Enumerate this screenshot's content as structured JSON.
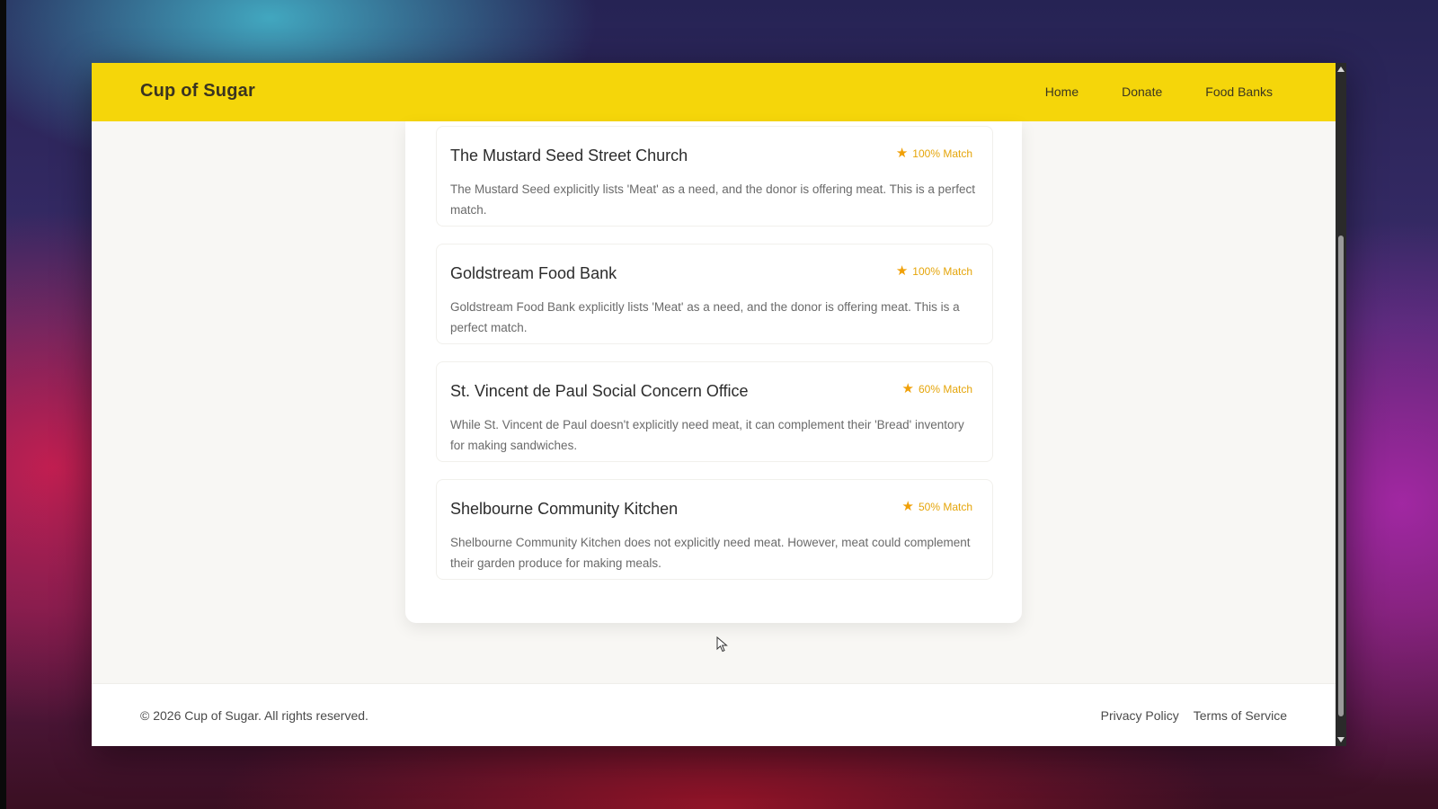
{
  "header": {
    "brand": "Cup of Sugar",
    "nav": [
      "Home",
      "Donate",
      "Food Banks"
    ]
  },
  "matches": [
    {
      "name": "The Mustard Seed Street Church",
      "match": "100% Match",
      "description": "The Mustard Seed explicitly lists 'Meat' as a need, and the donor is offering meat. This is a perfect match."
    },
    {
      "name": "Goldstream Food Bank",
      "match": "100% Match",
      "description": "Goldstream Food Bank explicitly lists 'Meat' as a need, and the donor is offering meat. This is a perfect match."
    },
    {
      "name": "St. Vincent de Paul Social Concern Office",
      "match": "60% Match",
      "description": "While St. Vincent de Paul doesn't explicitly need meat, it can complement their 'Bread' inventory for making sandwiches."
    },
    {
      "name": "Shelbourne Community Kitchen",
      "match": "50% Match",
      "description": "Shelbourne Community Kitchen does not explicitly need meat. However, meat could complement their garden produce for making meals."
    }
  ],
  "footer": {
    "copyright": "© 2026 Cup of Sugar. All rights reserved.",
    "links": [
      "Privacy Policy",
      "Terms of Service"
    ]
  },
  "icons": {
    "match_star": "star-icon",
    "cursor": "mouse-pointer-icon"
  },
  "colors": {
    "header_bg": "#f5d60a",
    "badge": "#e5a50a"
  }
}
